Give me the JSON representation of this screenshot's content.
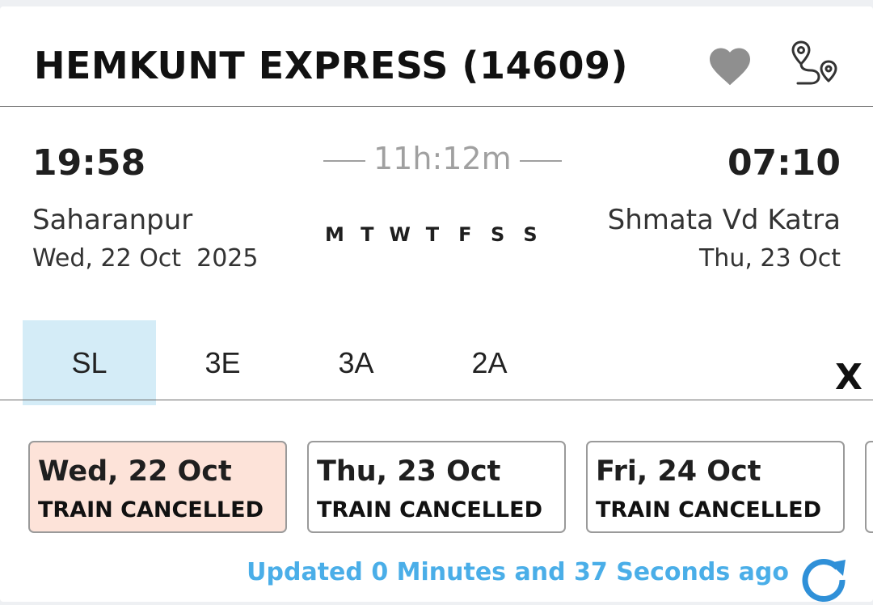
{
  "train": {
    "title": "HEMKUNT EXPRESS (14609)"
  },
  "icons": {
    "favorite": "heart-icon",
    "route": "route-map-icon",
    "refresh": "refresh-icon"
  },
  "colors": {
    "accent_blue": "#4aaee8",
    "active_tab_bg": "#d4ecf7",
    "selected_date_bg": "#fde3d9",
    "heart_gray": "#8f8f8f"
  },
  "journey": {
    "departure": {
      "time": "19:58",
      "station": "Saharanpur",
      "date": "Wed, 22 Oct  2025"
    },
    "arrival": {
      "time": "07:10",
      "station": "Shmata Vd Katra",
      "date": "Thu, 23 Oct"
    },
    "duration": "11h:12m",
    "running_days": [
      "M",
      "T",
      "W",
      "T",
      "F",
      "S",
      "S"
    ]
  },
  "classes": {
    "tabs": [
      {
        "label": "SL",
        "active": true
      },
      {
        "label": "3E",
        "active": false
      },
      {
        "label": "3A",
        "active": false
      },
      {
        "label": "2A",
        "active": false
      }
    ],
    "close_label": "X"
  },
  "availability": [
    {
      "date": "Wed, 22 Oct",
      "status": "TRAIN CANCELLED",
      "selected": true
    },
    {
      "date": "Thu, 23 Oct",
      "status": "TRAIN CANCELLED",
      "selected": false
    },
    {
      "date": "Fri, 24 Oct",
      "status": "TRAIN CANCELLED",
      "selected": false
    }
  ],
  "footer": {
    "updated_text": "Updated 0 Minutes and 37 Seconds ago"
  }
}
